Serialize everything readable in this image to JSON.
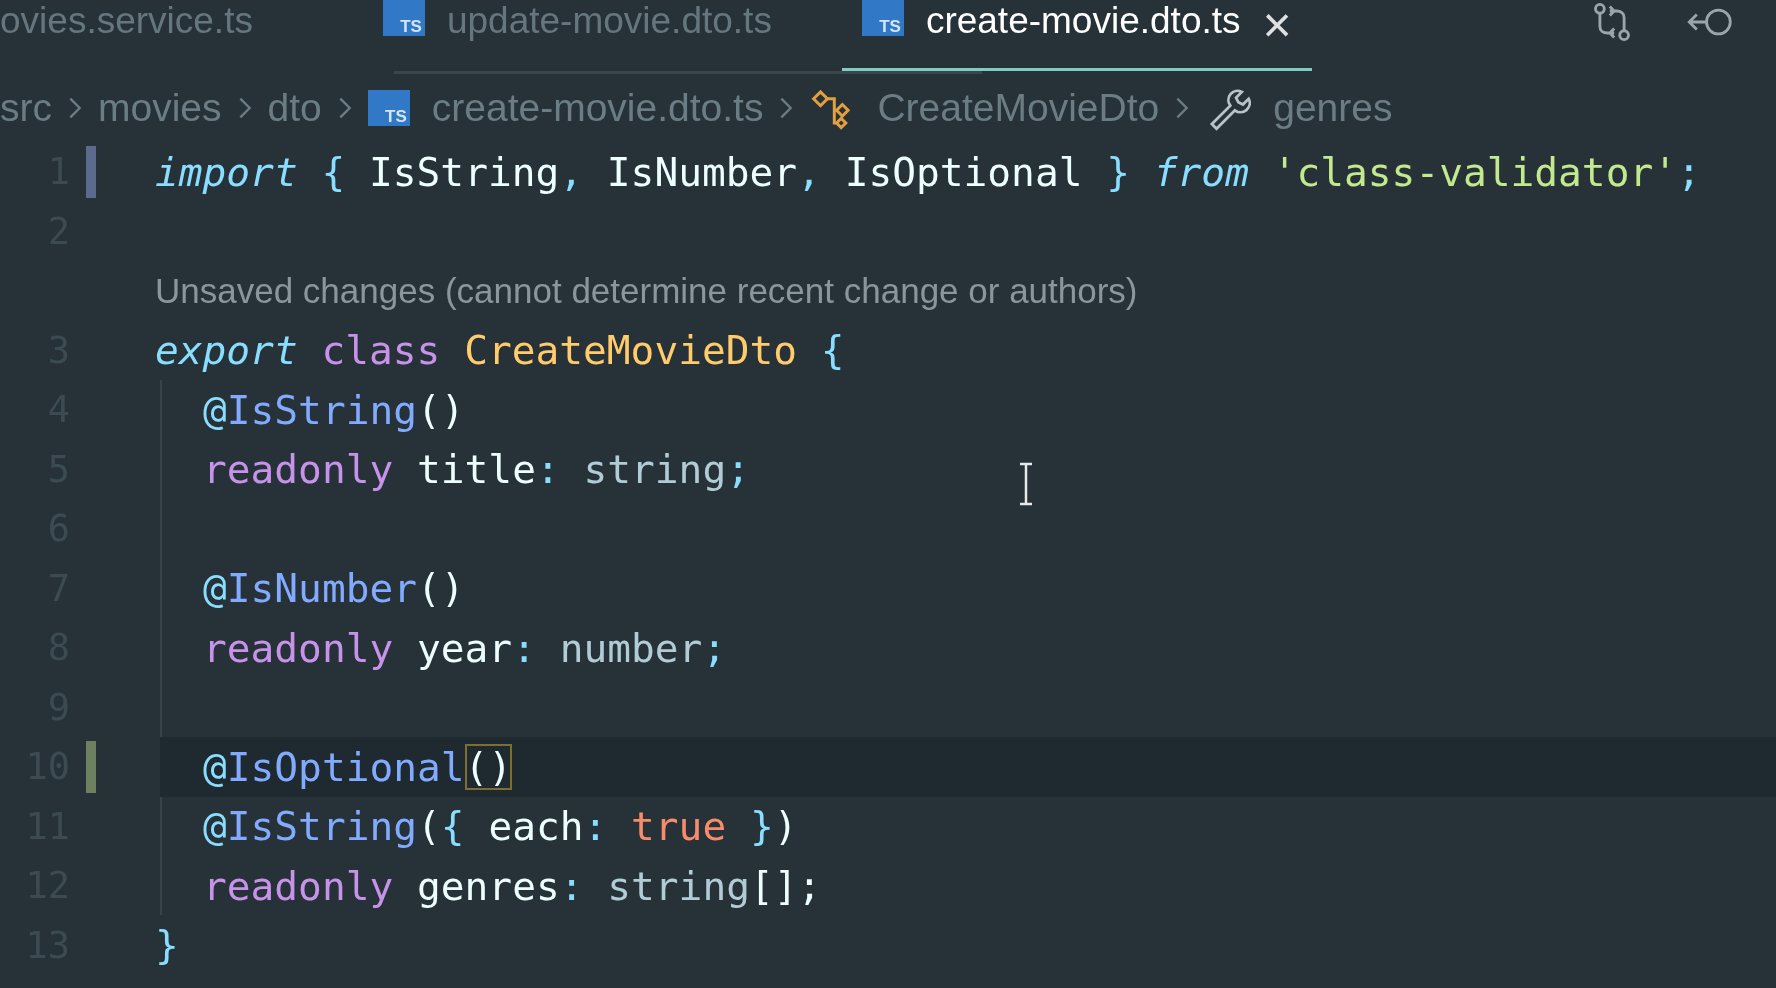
{
  "tabs": [
    {
      "label": "ovies.service.ts",
      "kind": "plain",
      "selected": false
    },
    {
      "label": "update-movie.dto.ts",
      "kind": "ts",
      "badge": "TS",
      "selected": false
    },
    {
      "label": "create-movie.dto.ts",
      "kind": "ts",
      "badge": "TS",
      "selected": true,
      "close": "×"
    }
  ],
  "breadcrumbs": [
    {
      "label": "src",
      "kind": "plain"
    },
    {
      "label": "movies",
      "kind": "plain"
    },
    {
      "label": "dto",
      "kind": "plain"
    },
    {
      "label": "create-movie.dto.ts",
      "kind": "ts",
      "badge": "TS"
    },
    {
      "label": "CreateMovieDto",
      "kind": "class"
    },
    {
      "label": "genres",
      "kind": "property"
    }
  ],
  "lines": [
    {
      "kind": "code",
      "number": "1",
      "modified": true,
      "added": false,
      "current": false,
      "indented": false,
      "tokens": [
        {
          "t": "import",
          "kind": "kwi"
        },
        {
          "t": " { ",
          "kind": "brace"
        },
        {
          "t": "IsString",
          "kind": "id"
        },
        {
          "t": ", ",
          "kind": "brace"
        },
        {
          "t": "IsNumber",
          "kind": "id"
        },
        {
          "t": ", ",
          "kind": "brace"
        },
        {
          "t": "IsOptional",
          "kind": "id"
        },
        {
          "t": " } ",
          "kind": "brace"
        },
        {
          "t": "from",
          "kind": "kwi"
        },
        {
          "t": " 'class-validator'",
          "kind": "str"
        },
        {
          "t": ";",
          "kind": "brace"
        }
      ]
    },
    {
      "kind": "code",
      "number": "2",
      "modified": false,
      "added": false,
      "current": false
    },
    {
      "kind": "codelens",
      "text": "Unsaved changes (cannot determine recent change or authors)"
    },
    {
      "kind": "code",
      "number": "3",
      "modified": false,
      "added": false,
      "current": false,
      "indented": false,
      "tokens": [
        {
          "t": "export",
          "kind": "kwi"
        },
        {
          "t": " class",
          "kind": "kw"
        },
        {
          "t": " CreateMovieDto",
          "kind": "cls"
        },
        {
          "t": " {",
          "kind": "brace"
        }
      ]
    },
    {
      "kind": "code",
      "number": "4",
      "modified": false,
      "added": false,
      "current": false,
      "indented": true,
      "tokens": [
        {
          "t": "@",
          "kind": "at"
        },
        {
          "t": "IsString",
          "kind": "fn"
        },
        {
          "t": "()",
          "kind": "id"
        }
      ]
    },
    {
      "kind": "code",
      "number": "5",
      "modified": false,
      "added": false,
      "current": false,
      "indented": true,
      "tokens": [
        {
          "t": "readonly",
          "kind": "kw"
        },
        {
          "t": " title",
          "kind": "id"
        },
        {
          "t": ": ",
          "kind": "brace"
        },
        {
          "t": "string",
          "kind": "type"
        },
        {
          "t": ";",
          "kind": "brace"
        }
      ]
    },
    {
      "kind": "code",
      "number": "6",
      "modified": false,
      "added": false,
      "current": false
    },
    {
      "kind": "code",
      "number": "7",
      "modified": false,
      "added": false,
      "current": false,
      "indented": true,
      "tokens": [
        {
          "t": "@",
          "kind": "at"
        },
        {
          "t": "IsNumber",
          "kind": "fn"
        },
        {
          "t": "()",
          "kind": "id"
        }
      ]
    },
    {
      "kind": "code",
      "number": "8",
      "modified": false,
      "added": false,
      "current": false,
      "indented": true,
      "tokens": [
        {
          "t": "readonly",
          "kind": "kw"
        },
        {
          "t": " year",
          "kind": "id"
        },
        {
          "t": ": ",
          "kind": "brace"
        },
        {
          "t": "number",
          "kind": "type"
        },
        {
          "t": ";",
          "kind": "brace"
        }
      ]
    },
    {
      "kind": "code",
      "number": "9",
      "modified": false,
      "added": false,
      "current": false
    },
    {
      "kind": "code",
      "number": "10",
      "modified": false,
      "added": true,
      "current": true,
      "indented": true,
      "tokens": [
        {
          "t": "@",
          "kind": "at"
        },
        {
          "t": "IsOptional",
          "kind": "fn"
        },
        {
          "t": "()",
          "kind": "id",
          "matched": true
        }
      ]
    },
    {
      "kind": "code",
      "number": "11",
      "modified": false,
      "added": false,
      "current": false,
      "indented": true,
      "tokens": [
        {
          "t": "@",
          "kind": "at"
        },
        {
          "t": "IsString",
          "kind": "fn"
        },
        {
          "t": "(",
          "kind": "id"
        },
        {
          "t": "{ ",
          "kind": "brace"
        },
        {
          "t": "each",
          "kind": "id"
        },
        {
          "t": ": ",
          "kind": "brace"
        },
        {
          "t": "true",
          "kind": "bool"
        },
        {
          "t": " }",
          "kind": "brace"
        },
        {
          "t": ")",
          "kind": "id"
        }
      ]
    },
    {
      "kind": "code",
      "number": "12",
      "modified": false,
      "added": false,
      "current": false,
      "indented": true,
      "tokens": [
        {
          "t": "readonly",
          "kind": "kw"
        },
        {
          "t": " genres",
          "kind": "id"
        },
        {
          "t": ": ",
          "kind": "brace"
        },
        {
          "t": "string",
          "kind": "type"
        },
        {
          "t": "[];",
          "kind": "id"
        }
      ]
    },
    {
      "kind": "code",
      "number": "13",
      "modified": false,
      "added": false,
      "current": false,
      "indented": false,
      "tokens": [
        {
          "t": "}",
          "kind": "brace"
        }
      ]
    }
  ]
}
